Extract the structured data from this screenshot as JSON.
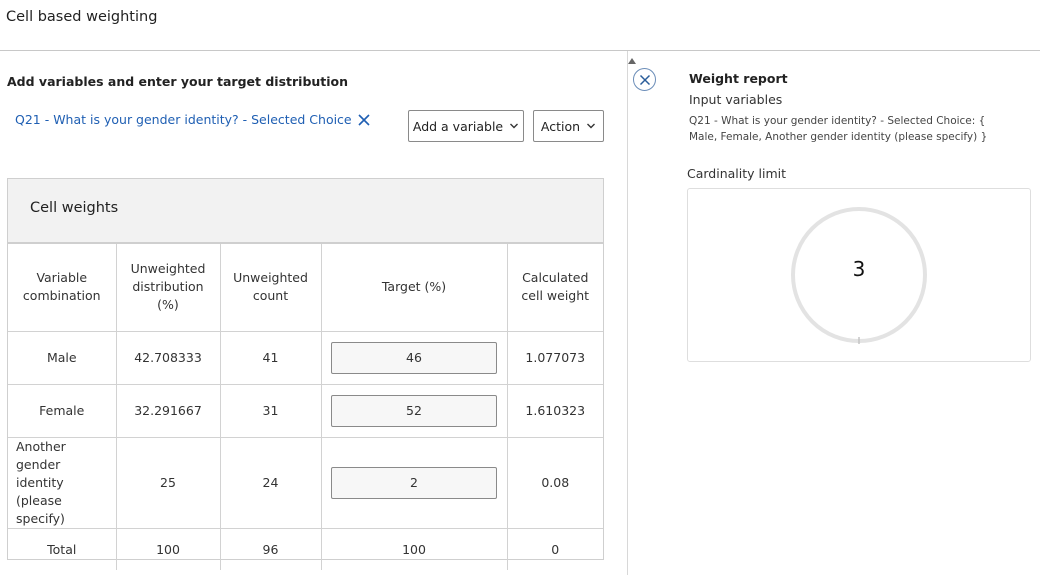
{
  "header": {
    "title": "Cell based weighting"
  },
  "left": {
    "section_title": "Add variables and enter your target distribution",
    "selected_variable": "Q21 - What is your gender identity? - Selected Choice",
    "add_variable_label": "Add a variable",
    "action_label": "Action"
  },
  "cell_weights": {
    "title": "Cell weights",
    "columns": [
      "Variable combination",
      "Unweighted distribution (%)",
      "Unweighted count",
      "Target (%)",
      "Calculated cell weight"
    ],
    "rows": [
      {
        "variable": "Male",
        "distribution": "42.708333",
        "count": "41",
        "target": "46",
        "weight": "1.077073"
      },
      {
        "variable": "Female",
        "distribution": "32.291667",
        "count": "31",
        "target": "52",
        "weight": "1.610323"
      },
      {
        "variable": "Another gender identity (please specify)",
        "distribution": "25",
        "count": "24",
        "target": "2",
        "weight": "0.08"
      }
    ],
    "total": {
      "variable": "Total",
      "distribution": "100",
      "count": "96",
      "target": "100",
      "weight": "0"
    }
  },
  "report": {
    "title": "Weight report",
    "input_variables_label": "Input variables",
    "input_variables_text": "Q21 - What is your gender identity? - Selected Choice: { Male, Female, Another gender identity (please specify) }",
    "cardinality_label": "Cardinality limit",
    "cardinality_value": "3"
  },
  "icons": [
    "remove-variable-icon",
    "chevron-down-icon",
    "close-icon",
    "scroll-up-icon"
  ],
  "colors": {
    "link": "#1f5fb3",
    "card_header_bg": "#f2f2f2",
    "gauge_ring": "#e3e3e3"
  }
}
